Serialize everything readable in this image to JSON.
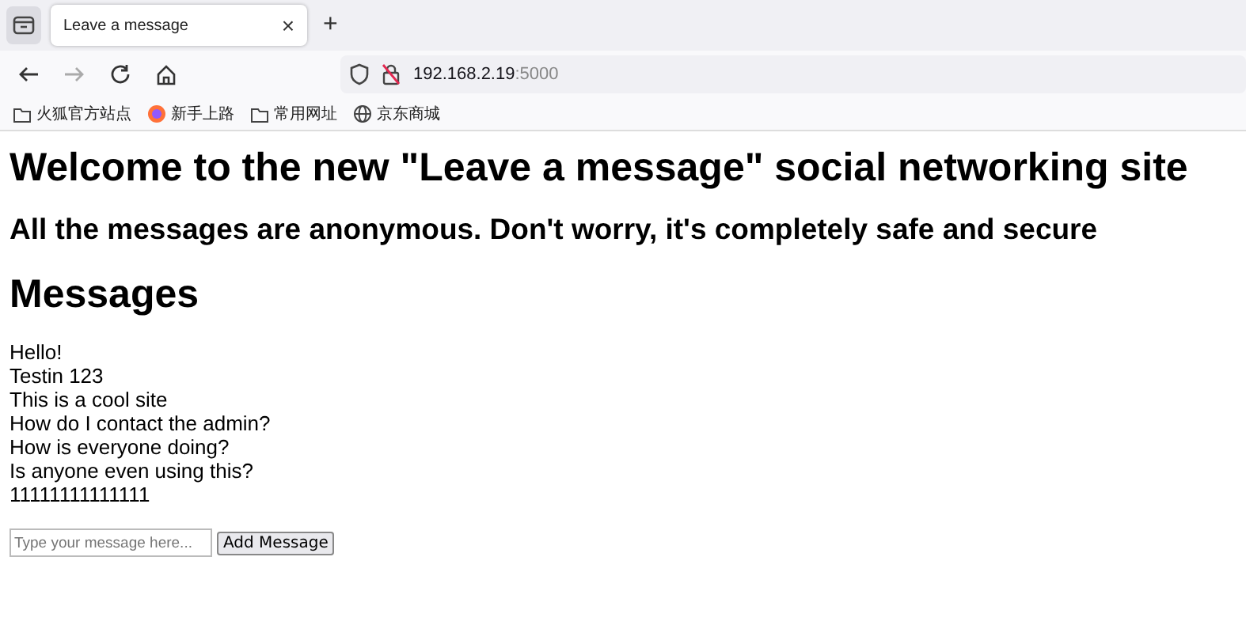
{
  "tab": {
    "title": "Leave a message",
    "close": "×",
    "selected": true
  },
  "new_tab": "+",
  "address": {
    "host": "192.168.2.19",
    "port": ":5000"
  },
  "bookmarks": [
    {
      "kind": "folder",
      "label": "火狐官方站点"
    },
    {
      "kind": "logo",
      "label": "新手上路"
    },
    {
      "kind": "folder",
      "label": "常用网址"
    },
    {
      "kind": "globe",
      "label": "京东商城"
    }
  ],
  "heading": "Welcome to the new \"Leave a message\" social networking site",
  "subheading": "All the messages are anonymous. Don't worry, it's completely safe and secure",
  "messages_title": "Messages",
  "messages": [
    "Hello!",
    "Testin 123",
    "This is a cool site",
    "How do I contact the admin?",
    "How is everyone doing?",
    "Is anyone even using this?",
    "11111111111111"
  ],
  "form": {
    "placeholder": "Type your message here...",
    "button": "Add Message"
  }
}
